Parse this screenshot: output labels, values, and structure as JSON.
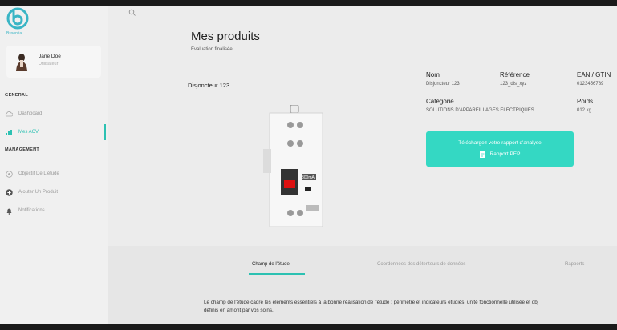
{
  "app": {
    "logo_text": "Bssentia",
    "accent": "#2cc1b2",
    "button_color": "#34d8c3"
  },
  "user": {
    "name": "Jane Doe",
    "role": "Utilisateur"
  },
  "sidebar": {
    "general_label": "GENERAL",
    "management_label": "MANAGEMENT",
    "items": [
      {
        "label": "Dashboard",
        "icon": "cloud-icon"
      },
      {
        "label": "Mes ACV",
        "icon": "chart-icon",
        "active": true
      },
      {
        "label": "Objectif De L'étude",
        "icon": "target-icon"
      },
      {
        "label": "Ajouter Un Produit",
        "icon": "plus-circle-icon"
      },
      {
        "label": "Notifications",
        "icon": "bell-icon"
      }
    ]
  },
  "main": {
    "title": "Mes produits",
    "subtitle": "Evaluation finalisée",
    "product_name": "Disjoncteur 123",
    "info": {
      "nom_label": "Nom",
      "nom_value": "Disjoncteur 123",
      "ref_label": "Référence",
      "ref_value": "123_dis_xyz",
      "ean_label": "EAN / GTIN",
      "ean_value": "0123456789",
      "cat_label": "Catégorie",
      "cat_value": "SOLUTIONS D'APPAREILLAGES ELECTRIQUES",
      "poids_label": "Poids",
      "poids_value": "012 kg"
    },
    "download": {
      "line1": "Téléchargez votre rapport d'analyse",
      "line2": "Rapport PEP"
    },
    "tabs": [
      {
        "label": "Champ de l'étude",
        "active": true
      },
      {
        "label": "Coordonnées des détenteurs de données",
        "active": false
      },
      {
        "label": "Rapports",
        "active": false
      }
    ],
    "description_line1": "Le champ de l'étude cadre les éléments essentiels à la bonne réalisation de l'étude : périmètre et indicateurs étudiés, unité fonctionnelle utilisée et obj",
    "description_line2": "définis en amont par vos soins."
  }
}
